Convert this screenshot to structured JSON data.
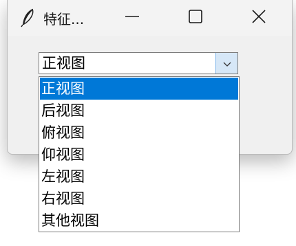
{
  "window": {
    "title": "特征...",
    "app_icon": "feather-icon",
    "controls": {
      "minimize_icon": "minimize-icon",
      "maximize_icon": "maximize-icon",
      "close_icon": "close-icon"
    }
  },
  "combobox": {
    "value": "正视图",
    "arrow_icon": "chevron-down-icon"
  },
  "dropdown": {
    "selected_index": 0,
    "options": [
      "正视图",
      "后视图",
      "俯视图",
      "仰视图",
      "左视图",
      "右视图",
      "其他视图"
    ]
  },
  "colors": {
    "selection": "#0078d7",
    "arrow_button": "#d6e7f7",
    "window_bg": "#f0f0f0"
  }
}
